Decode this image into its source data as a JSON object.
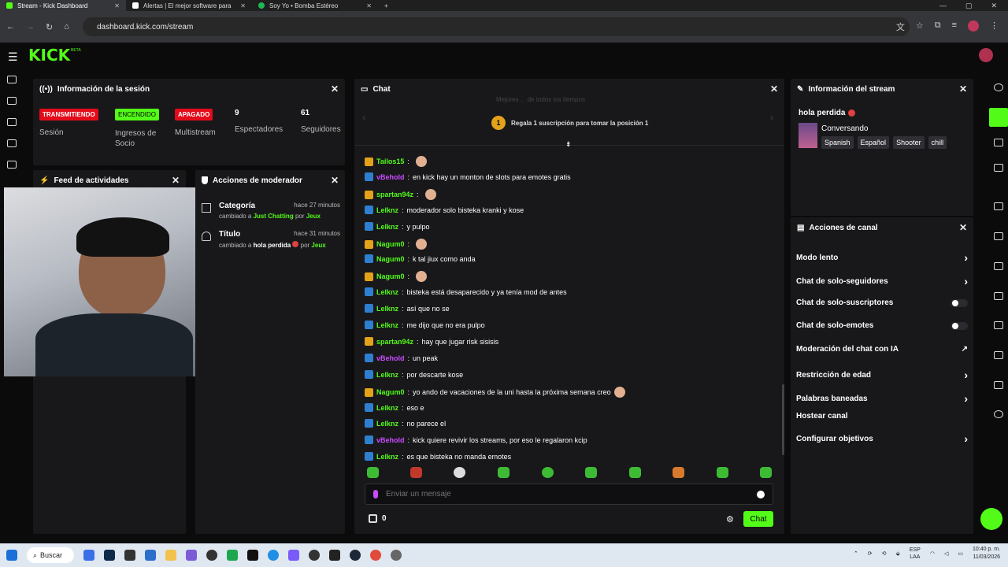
{
  "browser": {
    "tabs": [
      {
        "label": "Stream - Kick Dashboard"
      },
      {
        "label": "Alertas | El mejor software para"
      },
      {
        "label": "Soy Yo • Bomba Estéreo"
      }
    ],
    "url": "dashboard.kick.com/stream"
  },
  "app": {
    "logo": "KICK",
    "beta": "BETA"
  },
  "session": {
    "title": "Información de la sesión",
    "badges": [
      {
        "text": "TRANSMITIENDO",
        "label": "Sesión",
        "color": "#e30b1a"
      },
      {
        "text": "ENCENDIDO",
        "label": "Ingresos de Socio",
        "color": "#53fc18"
      },
      {
        "text": "APAGADO",
        "label": "Multistream",
        "color": "#e30b1a"
      }
    ],
    "viewers": {
      "value": "9",
      "label": "Espectadores"
    },
    "followers": {
      "value": "61",
      "label": "Seguidores"
    }
  },
  "feed": {
    "title": "Feed de actividades"
  },
  "modactions": {
    "title": "Acciones de moderador",
    "items": [
      {
        "title": "Categoría",
        "time": "hace 27 minutos",
        "pre": "cambiado a",
        "value": "Just Chatting",
        "by": "por",
        "user": "Jeux"
      },
      {
        "title": "Título",
        "time": "hace 31 minutos",
        "pre": "cambiado a",
        "value": "hola perdida",
        "by": "por",
        "user": "Jeux"
      }
    ]
  },
  "chat": {
    "title": "Chat",
    "promo": "Regala 1 suscripción para tomar la posición 1",
    "promo_rank": "1",
    "faded": "Mejores ... de todos los tiempos",
    "messages": [
      {
        "user": "Tailos15",
        "text": "",
        "color": "#53fc18",
        "icon": "sub",
        "emoji": true
      },
      {
        "user": "vBehold",
        "text": "en kick hay un monton de slots para emotes gratis",
        "color": "#c94bff",
        "icon": "mod"
      },
      {
        "user": "spartan94z",
        "text": "",
        "color": "#53fc18",
        "icon": "sub",
        "emoji": true
      },
      {
        "user": "Lelknz",
        "text": "moderador solo bisteka kranki y kose",
        "color": "#53fc18",
        "icon": "mod"
      },
      {
        "user": "Lelknz",
        "text": "y pulpo",
        "color": "#53fc18",
        "icon": "mod"
      },
      {
        "user": "Nagum0",
        "text": "",
        "color": "#53fc18",
        "icon": "sub",
        "emoji": true
      },
      {
        "user": "Nagum0",
        "text": "k tal jiux como anda",
        "color": "#53fc18",
        "icon": "mod"
      },
      {
        "user": "Nagum0",
        "text": "",
        "color": "#53fc18",
        "icon": "sub",
        "emoji": true
      },
      {
        "user": "Lelknz",
        "text": "bisteka está desaparecido y ya tenía mod de antes",
        "color": "#53fc18",
        "icon": "mod"
      },
      {
        "user": "Lelknz",
        "text": "así que no se",
        "color": "#53fc18",
        "icon": "mod"
      },
      {
        "user": "Lelknz",
        "text": "me dijo que no era pulpo",
        "color": "#53fc18",
        "icon": "mod"
      },
      {
        "user": "spartan94z",
        "text": "hay que jugar risk sisisis",
        "color": "#53fc18",
        "icon": "sub"
      },
      {
        "user": "vBehold",
        "text": "un peak",
        "color": "#c94bff",
        "icon": "mod"
      },
      {
        "user": "Lelknz",
        "text": "por descarte kose",
        "color": "#53fc18",
        "icon": "mod"
      },
      {
        "user": "Nagum0",
        "text": "yo ando de vacaciones de la uni hasta la próxima semana creo",
        "color": "#53fc18",
        "icon": "sub",
        "emoji": true
      },
      {
        "user": "Lelknz",
        "text": "eso e",
        "color": "#53fc18",
        "icon": "mod"
      },
      {
        "user": "Lelknz",
        "text": "no parece el",
        "color": "#53fc18",
        "icon": "mod"
      },
      {
        "user": "vBehold",
        "text": "kick quiere revivir los streams, por eso le regalaron kcip",
        "color": "#c94bff",
        "icon": "mod"
      },
      {
        "user": "Lelknz",
        "text": "es que bisteka no manda emotes",
        "color": "#53fc18",
        "icon": "mod"
      }
    ],
    "placeholder": "Enviar un mensaje",
    "points": "0",
    "send": "Chat"
  },
  "streaminfo": {
    "title": "Información del stream",
    "stream_title": "hola perdida",
    "category": "Conversando",
    "tags": [
      "Spanish",
      "Español",
      "Shooter",
      "chill"
    ]
  },
  "channel": {
    "title": "Acciones de canal",
    "rows": [
      {
        "label": "Modo lento",
        "kind": "chev"
      },
      {
        "label": "Chat de solo-seguidores",
        "kind": "chev"
      },
      {
        "label": "Chat de solo-suscriptores",
        "kind": "toggle"
      },
      {
        "label": "Chat de solo-emotes",
        "kind": "toggle"
      },
      {
        "label": "Moderación del chat con IA",
        "kind": "ext"
      },
      {
        "label": "Restricción de edad",
        "kind": "chev"
      },
      {
        "label": "Palabras baneadas",
        "kind": "chev"
      },
      {
        "label": "Hostear canal",
        "kind": "none"
      },
      {
        "label": "Configurar objetivos",
        "kind": "chev"
      }
    ]
  },
  "taskbar": {
    "search": "Buscar",
    "lang": "ESP",
    "layout": "LAA",
    "time": "10:40 p. m.",
    "date": "11/03/2026"
  }
}
